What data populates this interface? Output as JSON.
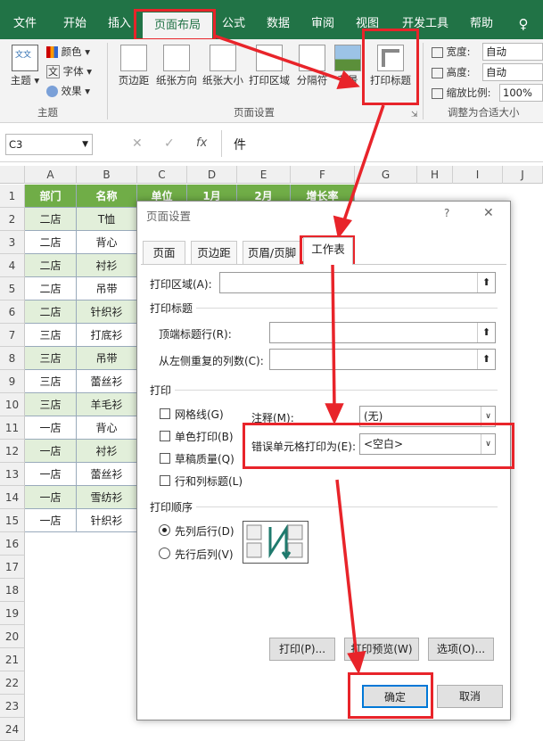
{
  "ribbon_tabs": [
    "文件",
    "开始",
    "插入",
    "页面布局",
    "公式",
    "数据",
    "审阅",
    "视图",
    "开发工具",
    "帮助"
  ],
  "ribbon": {
    "theme_btn": "主题",
    "colors": "颜色",
    "fonts": "字体",
    "effects": "效果",
    "margins": "页边距",
    "orientation": "纸张方向",
    "size": "纸张大小",
    "print_area": "打印区域",
    "breaks": "分隔符",
    "background": "背景",
    "print_titles": "打印标题",
    "width_label": "宽度:",
    "width_val": "自动",
    "height_label": "高度:",
    "height_val": "自动",
    "scale_label": "缩放比例:",
    "scale_val": "100%",
    "group_theme": "主题",
    "group_page_setup": "页面设置",
    "group_fit": "调整为合适大小"
  },
  "formula_bar": {
    "name_box": "C3",
    "content": "件"
  },
  "columns": [
    "A",
    "B",
    "C",
    "D",
    "E",
    "F",
    "G",
    "H",
    "I",
    "J"
  ],
  "rows": [
    "1",
    "2",
    "3",
    "4",
    "5",
    "6",
    "7",
    "8",
    "9",
    "10",
    "11",
    "12",
    "13",
    "14",
    "15",
    "16",
    "17",
    "18",
    "19",
    "20",
    "21",
    "22",
    "23",
    "24"
  ],
  "table": {
    "headers": [
      "部门",
      "名称",
      "单位",
      "1月",
      "2月",
      "增长率"
    ],
    "data": [
      [
        "二店",
        "T恤"
      ],
      [
        "二店",
        "背心"
      ],
      [
        "二店",
        "衬衫"
      ],
      [
        "二店",
        "吊带"
      ],
      [
        "二店",
        "针织衫"
      ],
      [
        "三店",
        "打底衫"
      ],
      [
        "三店",
        "吊带"
      ],
      [
        "三店",
        "蕾丝衫"
      ],
      [
        "三店",
        "羊毛衫"
      ],
      [
        "一店",
        "背心"
      ],
      [
        "一店",
        "衬衫"
      ],
      [
        "一店",
        "蕾丝衫"
      ],
      [
        "一店",
        "雪纺衫"
      ],
      [
        "一店",
        "针织衫"
      ]
    ]
  },
  "dialog": {
    "title": "页面设置",
    "help": "?",
    "close": "✕",
    "tabs": [
      "页面",
      "页边距",
      "页眉/页脚",
      "工作表"
    ],
    "print_area": "打印区域(A):",
    "print_titles_section": "打印标题",
    "rows_repeat": "顶端标题行(R):",
    "cols_repeat": "从左侧重复的列数(C):",
    "print_section": "打印",
    "gridlines": "网格线(G)",
    "bw": "单色打印(B)",
    "draft": "草稿质量(Q)",
    "rc_headings": "行和列标题(L)",
    "comments_label": "注释(M):",
    "comments_val": "(无)",
    "errors_label": "错误单元格打印为(E):",
    "errors_val": "<空白>",
    "order_section": "打印顺序",
    "down_then_over": "先列后行(D)",
    "over_then_down": "先行后列(V)",
    "print_btn": "打印(P)...",
    "preview_btn": "打印预览(W)",
    "options_btn": "选项(O)...",
    "ok": "确定",
    "cancel": "取消"
  },
  "colors": {
    "excel_green": "#217346",
    "header_green": "#70ad47",
    "band_green": "#e2efda",
    "highlight_red": "#e8242a"
  }
}
